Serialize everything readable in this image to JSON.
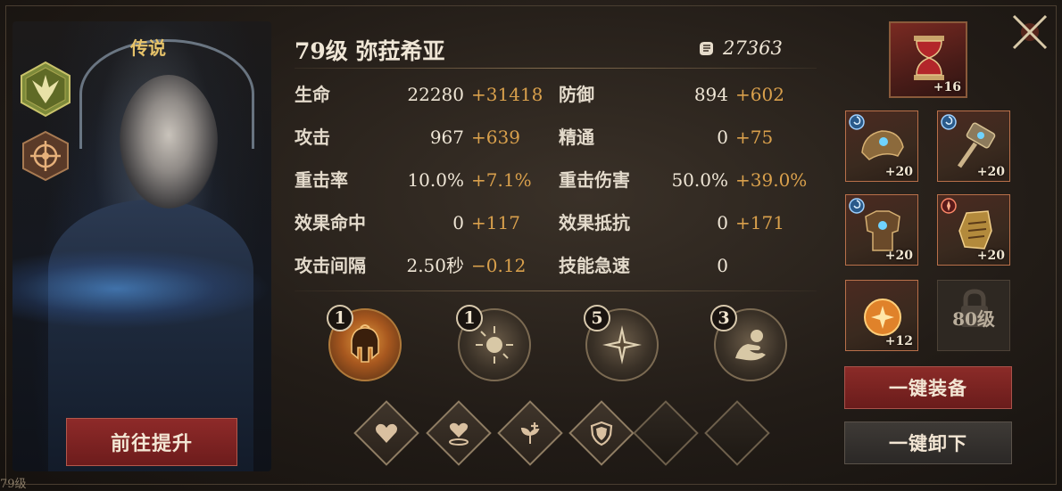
{
  "hero": {
    "rarity": "传说",
    "name": "79级  弥菈希亚",
    "power": "27363",
    "upgrade_label": "前往提升",
    "corner_level": "79级"
  },
  "stats": [
    {
      "label": "生命",
      "base": "22280",
      "bonus": "+31418"
    },
    {
      "label": "防御",
      "base": "894",
      "bonus": "+602"
    },
    {
      "label": "攻击",
      "base": "967",
      "bonus": "+639"
    },
    {
      "label": "精通",
      "base": "0",
      "bonus": "+75"
    },
    {
      "label": "重击率",
      "base": "10.0%",
      "bonus": "+7.1%"
    },
    {
      "label": "重击伤害",
      "base": "50.0%",
      "bonus": "+39.0%"
    },
    {
      "label": "效果命中",
      "base": "0",
      "bonus": "+117"
    },
    {
      "label": "效果抵抗",
      "base": "0",
      "bonus": "+171"
    },
    {
      "label": "攻击间隔",
      "base": "2.50秒",
      "bonus": "−0.12"
    },
    {
      "label": "技能急速",
      "base": "0",
      "bonus": ""
    }
  ],
  "skills": [
    {
      "level": "1",
      "icon": "spartan-helmet-icon"
    },
    {
      "level": "1",
      "icon": "orb-burst-icon"
    },
    {
      "level": "5",
      "icon": "compass-star-icon"
    },
    {
      "level": "3",
      "icon": "hand-orb-icon"
    }
  ],
  "runes": [
    {
      "icon": "heart-icon",
      "filled": true
    },
    {
      "icon": "heart-pedestal-icon",
      "filled": true
    },
    {
      "icon": "sprout-plus-icon",
      "filled": true
    },
    {
      "icon": "shield-icon",
      "filled": true
    },
    {
      "icon": "empty-slot",
      "filled": false
    },
    {
      "icon": "empty-slot",
      "filled": false
    }
  ],
  "equipment": {
    "artifact": {
      "level": "+16",
      "icon": "hourglass-icon"
    },
    "slots": [
      {
        "level": "+20",
        "icon": "pauldron-icon"
      },
      {
        "level": "+20",
        "icon": "hammer-icon"
      },
      {
        "level": "+20",
        "icon": "chest-armor-icon"
      },
      {
        "level": "+20",
        "icon": "gauntlet-icon"
      },
      {
        "level": "+12",
        "icon": "amber-gem-icon"
      }
    ],
    "locked_label": "80级",
    "equip_all_label": "一键装备",
    "unequip_all_label": "一键卸下"
  },
  "colors": {
    "bonus": "#d9a04c",
    "button_red": "#8b2b28",
    "rarity": "#e6c36a"
  }
}
